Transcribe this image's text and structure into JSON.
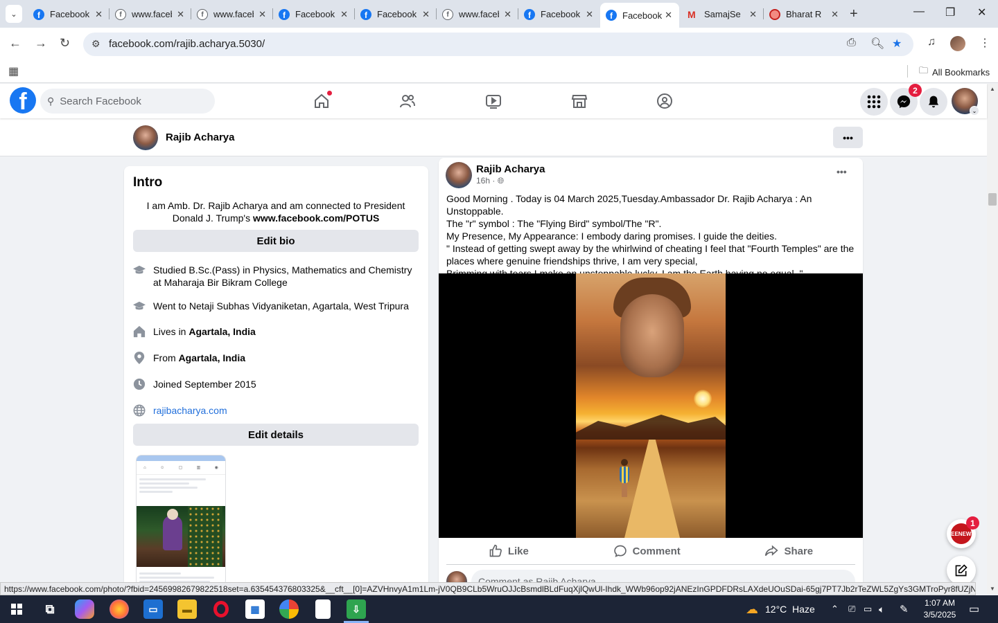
{
  "browser": {
    "tabs": [
      {
        "title": "Facebook",
        "icon": "facebook-icon"
      },
      {
        "title": "www.facebook.com",
        "icon": "facebook-grey-icon"
      },
      {
        "title": "www.facebook.com",
        "icon": "facebook-grey-icon"
      },
      {
        "title": "Facebook",
        "icon": "facebook-icon"
      },
      {
        "title": "Facebook",
        "icon": "facebook-icon"
      },
      {
        "title": "www.facebook.com",
        "icon": "facebook-grey-icon"
      },
      {
        "title": "Facebook",
        "icon": "facebook-icon"
      },
      {
        "title": "Facebook",
        "icon": "facebook-icon",
        "active": true
      },
      {
        "title": "SamajSe",
        "icon": "gmail-icon"
      },
      {
        "title": "Bharat R",
        "icon": "bharat-icon"
      }
    ],
    "url": "facebook.com/rajib.acharya.5030/",
    "bookmarks_label": "All Bookmarks"
  },
  "fb_nav": {
    "search_placeholder": "Search Facebook",
    "messenger_badge": "2"
  },
  "profile_header": {
    "name": "Rajib Acharya",
    "more": "•••"
  },
  "intro": {
    "title": "Intro",
    "bio_text": "I am Amb. Dr. Rajib Acharya and am connected to President Donald J. Trump's ",
    "bio_link": "www.facebook.com/POTUS",
    "edit_bio": "Edit bio",
    "studied": "Studied B.Sc.(Pass) in Physics, Mathematics and Chemistry at Maharaja Bir Bikram College",
    "went_to": "Went to Netaji Subhas Vidyaniketan, Agartala, West Tripura",
    "lives_prefix": "Lives in ",
    "lives_place": "Agartala, India",
    "from_prefix": "From ",
    "from_place": "Agartala, India",
    "joined": "Joined September 2015",
    "website": "rajibacharya.com",
    "edit_details": "Edit details"
  },
  "post": {
    "author": "Rajib Acharya",
    "time": "16h ·",
    "more": "•••",
    "text_lines": [
      "Good Morning . Today is 04 March 2025,Tuesday.Ambassador Dr. Rajib Acharya : An Unstoppable.",
      "The \"r\" symbol : The \"Flying Bird\" symbol/The \"R\".",
      "My Presence, My Appearance: I embody daring promises. I guide the deities.",
      "\" Instead of getting swept away by the whirlwind of cheating I feel that \"Fourth Temples\" are the places where genuine friendships thrive, I am very special,",
      "Brimming with tears I make an unstoppable lucky, I am the Earth having no equal. \""
    ],
    "like": "Like",
    "comment": "Comment",
    "share": "Share",
    "comment_placeholder": "Comment as Rajib Acharya"
  },
  "floating": {
    "news_badge": "1",
    "news_label": "ZEENEWS"
  },
  "status_url": "https://www.facebook.com/photo/?fbid=24569982679822518set=a.635454376803325&__cft__[0]=AZVHnvyA1m1Lm-jV0QB9CLb5WruOJJcBsmdlBLdFuqXjlQwUl-Ihdk_WWb96op92jANEzInGPDFDRsLAXdeUOuSDai-65gj7PT7Jb2rTeZWL5ZgYs3GMTroPyr8fUZjN83M...",
  "taskbar": {
    "weather": "12°C  Haze",
    "time": "1:07 AM",
    "date": "3/5/2025"
  }
}
